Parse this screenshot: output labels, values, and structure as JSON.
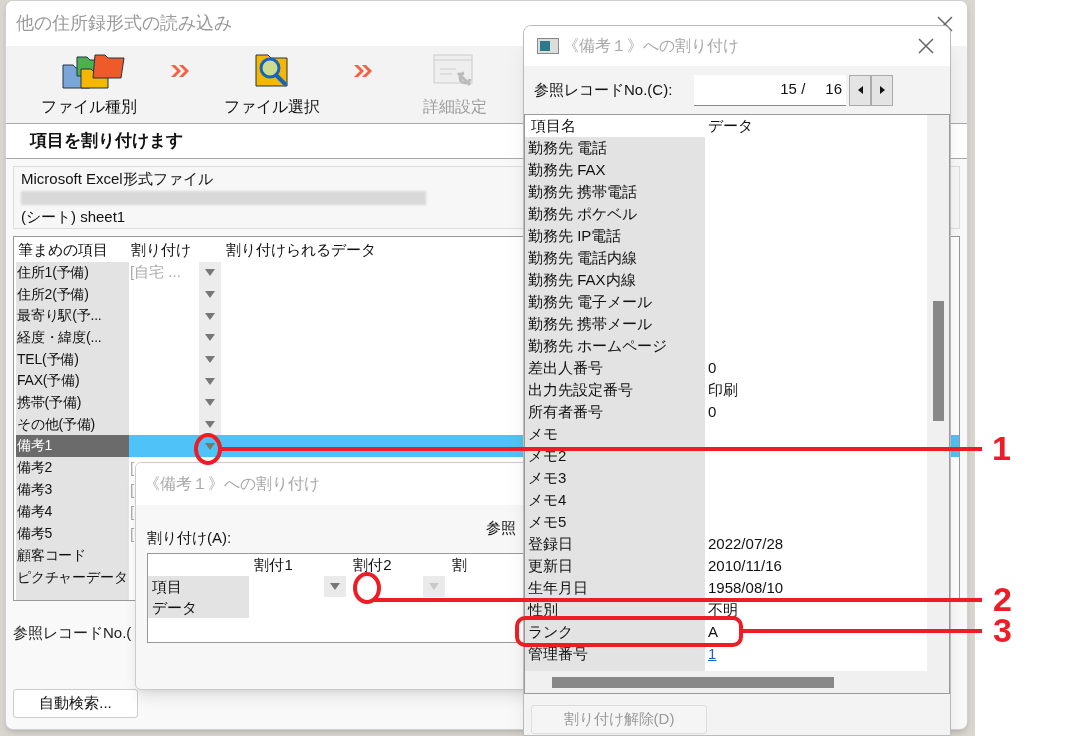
{
  "main_window": {
    "title": "他の住所録形式の読み込み",
    "steps": [
      {
        "label": "ファイル種別",
        "disabled": false
      },
      {
        "label": "ファイル選択",
        "disabled": false
      },
      {
        "label": "詳細設定",
        "disabled": true
      }
    ],
    "heading": "項目を割り付けます",
    "file_info": {
      "type": "Microsoft Excel形式ファイル",
      "sheet": "(シート) sheet1"
    },
    "table": {
      "columns": [
        "筆まめの項目",
        "割り付け",
        "割り付けられるデータ"
      ],
      "rows": [
        {
          "item": "住所1(予備)",
          "assignment": "[自宅 ...",
          "dropdown": true,
          "selected": false
        },
        {
          "item": "住所2(予備)",
          "dropdown": true,
          "selected": false
        },
        {
          "item": "最寄り駅(予...",
          "dropdown": true,
          "selected": false
        },
        {
          "item": "経度・緯度(...",
          "dropdown": true,
          "selected": false
        },
        {
          "item": "TEL(予備)",
          "dropdown": true,
          "selected": false
        },
        {
          "item": "FAX(予備)",
          "dropdown": true,
          "selected": false
        },
        {
          "item": "携帯(予備)",
          "dropdown": true,
          "selected": false
        },
        {
          "item": "その他(予備)",
          "dropdown": true,
          "selected": false
        },
        {
          "item": "備考1",
          "dropdown": true,
          "selected": true
        },
        {
          "item": "備考2",
          "assignment": "[",
          "dropdown": false,
          "selected": false
        },
        {
          "item": "備考3",
          "assignment": "[",
          "dropdown": false,
          "selected": false
        },
        {
          "item": "備考4",
          "assignment": "[",
          "dropdown": false,
          "selected": false
        },
        {
          "item": "備考5",
          "assignment": "[",
          "dropdown": false,
          "selected": false
        },
        {
          "item": "顧客コード",
          "dropdown": false,
          "selected": false
        },
        {
          "item": "ピクチャーデータ",
          "dropdown": false,
          "selected": false
        }
      ]
    },
    "reference_label": "参照レコードNo.(",
    "auto_search_button": "自動検索..."
  },
  "back_dialog": {
    "title": "《備考１》への割り付け",
    "assign_label": "割り付け(A):",
    "reference_label": "参照",
    "grid": {
      "columns": [
        "割付1",
        "割付2",
        "割"
      ],
      "rows": [
        "項目",
        "データ"
      ]
    }
  },
  "front_dialog": {
    "title": "《備考１》への割り付け",
    "reference_label": "参照レコードNo.(C):",
    "record_current": "15 /",
    "record_total": "16",
    "columns": [
      "項目名",
      "データ"
    ],
    "rows": [
      {
        "name": "勤務先 電話"
      },
      {
        "name": "勤務先 FAX"
      },
      {
        "name": "勤務先 携帯電話"
      },
      {
        "name": "勤務先 ポケベル"
      },
      {
        "name": "勤務先 IP電話"
      },
      {
        "name": "勤務先 電話内線"
      },
      {
        "name": "勤務先 FAX内線"
      },
      {
        "name": "勤務先 電子メール"
      },
      {
        "name": "勤務先 携帯メール"
      },
      {
        "name": "勤務先 ホームページ"
      },
      {
        "name": "差出人番号",
        "value": "0"
      },
      {
        "name": "出力先設定番号",
        "value": "印刷"
      },
      {
        "name": "所有者番号",
        "value": "0"
      },
      {
        "name": "メモ"
      },
      {
        "name": "メモ2"
      },
      {
        "name": "メモ3"
      },
      {
        "name": "メモ4"
      },
      {
        "name": "メモ5"
      },
      {
        "name": "登録日",
        "value": "2022/07/28"
      },
      {
        "name": "更新日",
        "value": "2010/11/16"
      },
      {
        "name": "生年月日",
        "value": "1958/08/10"
      },
      {
        "name": "性別",
        "value": "不明"
      },
      {
        "name": "ランク",
        "value": "A"
      },
      {
        "name": "管理番号",
        "value": "1",
        "kind": "link"
      }
    ],
    "unassign_button": {
      "label": "割り付け解除(D)",
      "disabled": true
    }
  },
  "annotations": [
    {
      "label": "1"
    },
    {
      "label": "2"
    },
    {
      "label": "3"
    }
  ]
}
